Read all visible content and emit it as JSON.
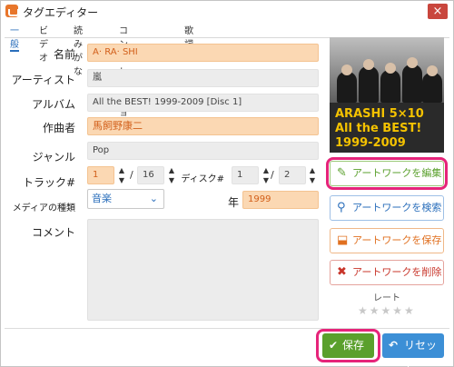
{
  "window": {
    "title": "タグエディター",
    "close_glyph": "×"
  },
  "tabs": [
    "一般",
    "ビデオ",
    "読みがな",
    "コンピレーション",
    "歌詞"
  ],
  "fields": {
    "title_label": "名前",
    "title_value": "A· RA· SHI",
    "artist_label": "アーティスト",
    "artist_value": "嵐",
    "album_label": "アルバム",
    "album_value": "All the BEST! 1999-2009 [Disc 1]",
    "composer_label": "作曲者",
    "composer_value": "馬飼野康二",
    "genre_label": "ジャンル",
    "genre_value": "Pop",
    "track_label": "トラック#",
    "track_value": "1",
    "track_total": "16",
    "disc_label": "ディスク#",
    "disc_value": "1",
    "disc_total": "2",
    "media_label": "メディアの種類",
    "media_value": "音楽",
    "year_label": "年",
    "year_value": "1999",
    "comment_label": "コメント"
  },
  "cover": {
    "line1": "ARASHI 5×10",
    "line2": "All the BEST!",
    "line3": "1999-2009"
  },
  "actions": {
    "edit_artwork": "アートワークを編集",
    "search_artwork": "アートワークを検索",
    "save_artwork": "アートワークを保存",
    "delete_artwork": "アートワークを削除"
  },
  "rating": {
    "label": "レート",
    "stars": "★★★★★",
    "value": 0
  },
  "footer": {
    "save": "保存",
    "reset": "リセット"
  },
  "colors": {
    "accent_orange": "#fbd8b3",
    "save_green": "#5aa02c",
    "reset_blue": "#3c8fd6",
    "highlight": "#e6247a"
  }
}
